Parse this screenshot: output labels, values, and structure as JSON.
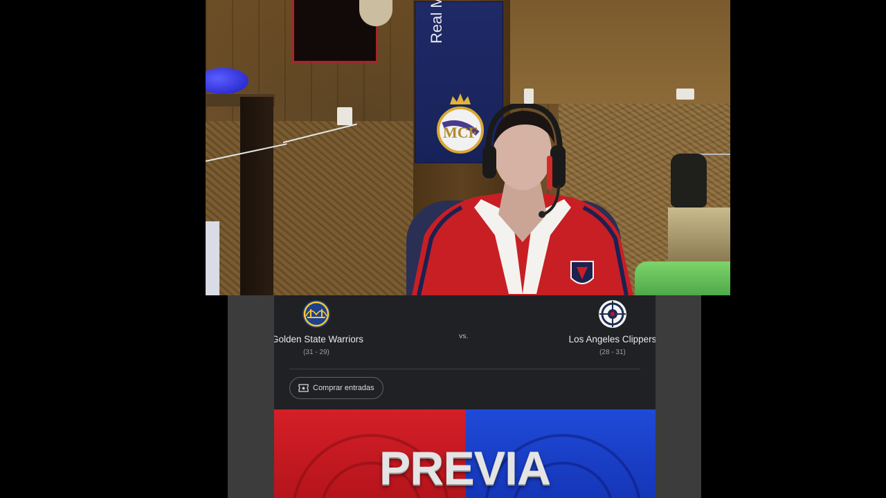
{
  "webcam": {
    "flag_text": "Real Madrid"
  },
  "game": {
    "home": {
      "name": "Golden State Warriors",
      "record": "(31 - 29)",
      "color": "#1d428a",
      "accent": "#ffc72c"
    },
    "away": {
      "name": "Los Angeles Clippers",
      "record": "(28 - 31)",
      "color": "#1d428a",
      "accent": "#c8102e"
    },
    "vs_label": "vs.",
    "tickets_label": "Comprar entradas",
    "tickets_icon": "ticket-icon"
  },
  "video": {
    "title": "PREVIA",
    "left_color": "#d51f27",
    "right_color": "#1f4ad8"
  },
  "colors": {
    "card_bg": "#202124",
    "panel_bg": "#3c3c3c",
    "text_primary": "#e8eaed",
    "text_secondary": "#9aa0a6"
  }
}
